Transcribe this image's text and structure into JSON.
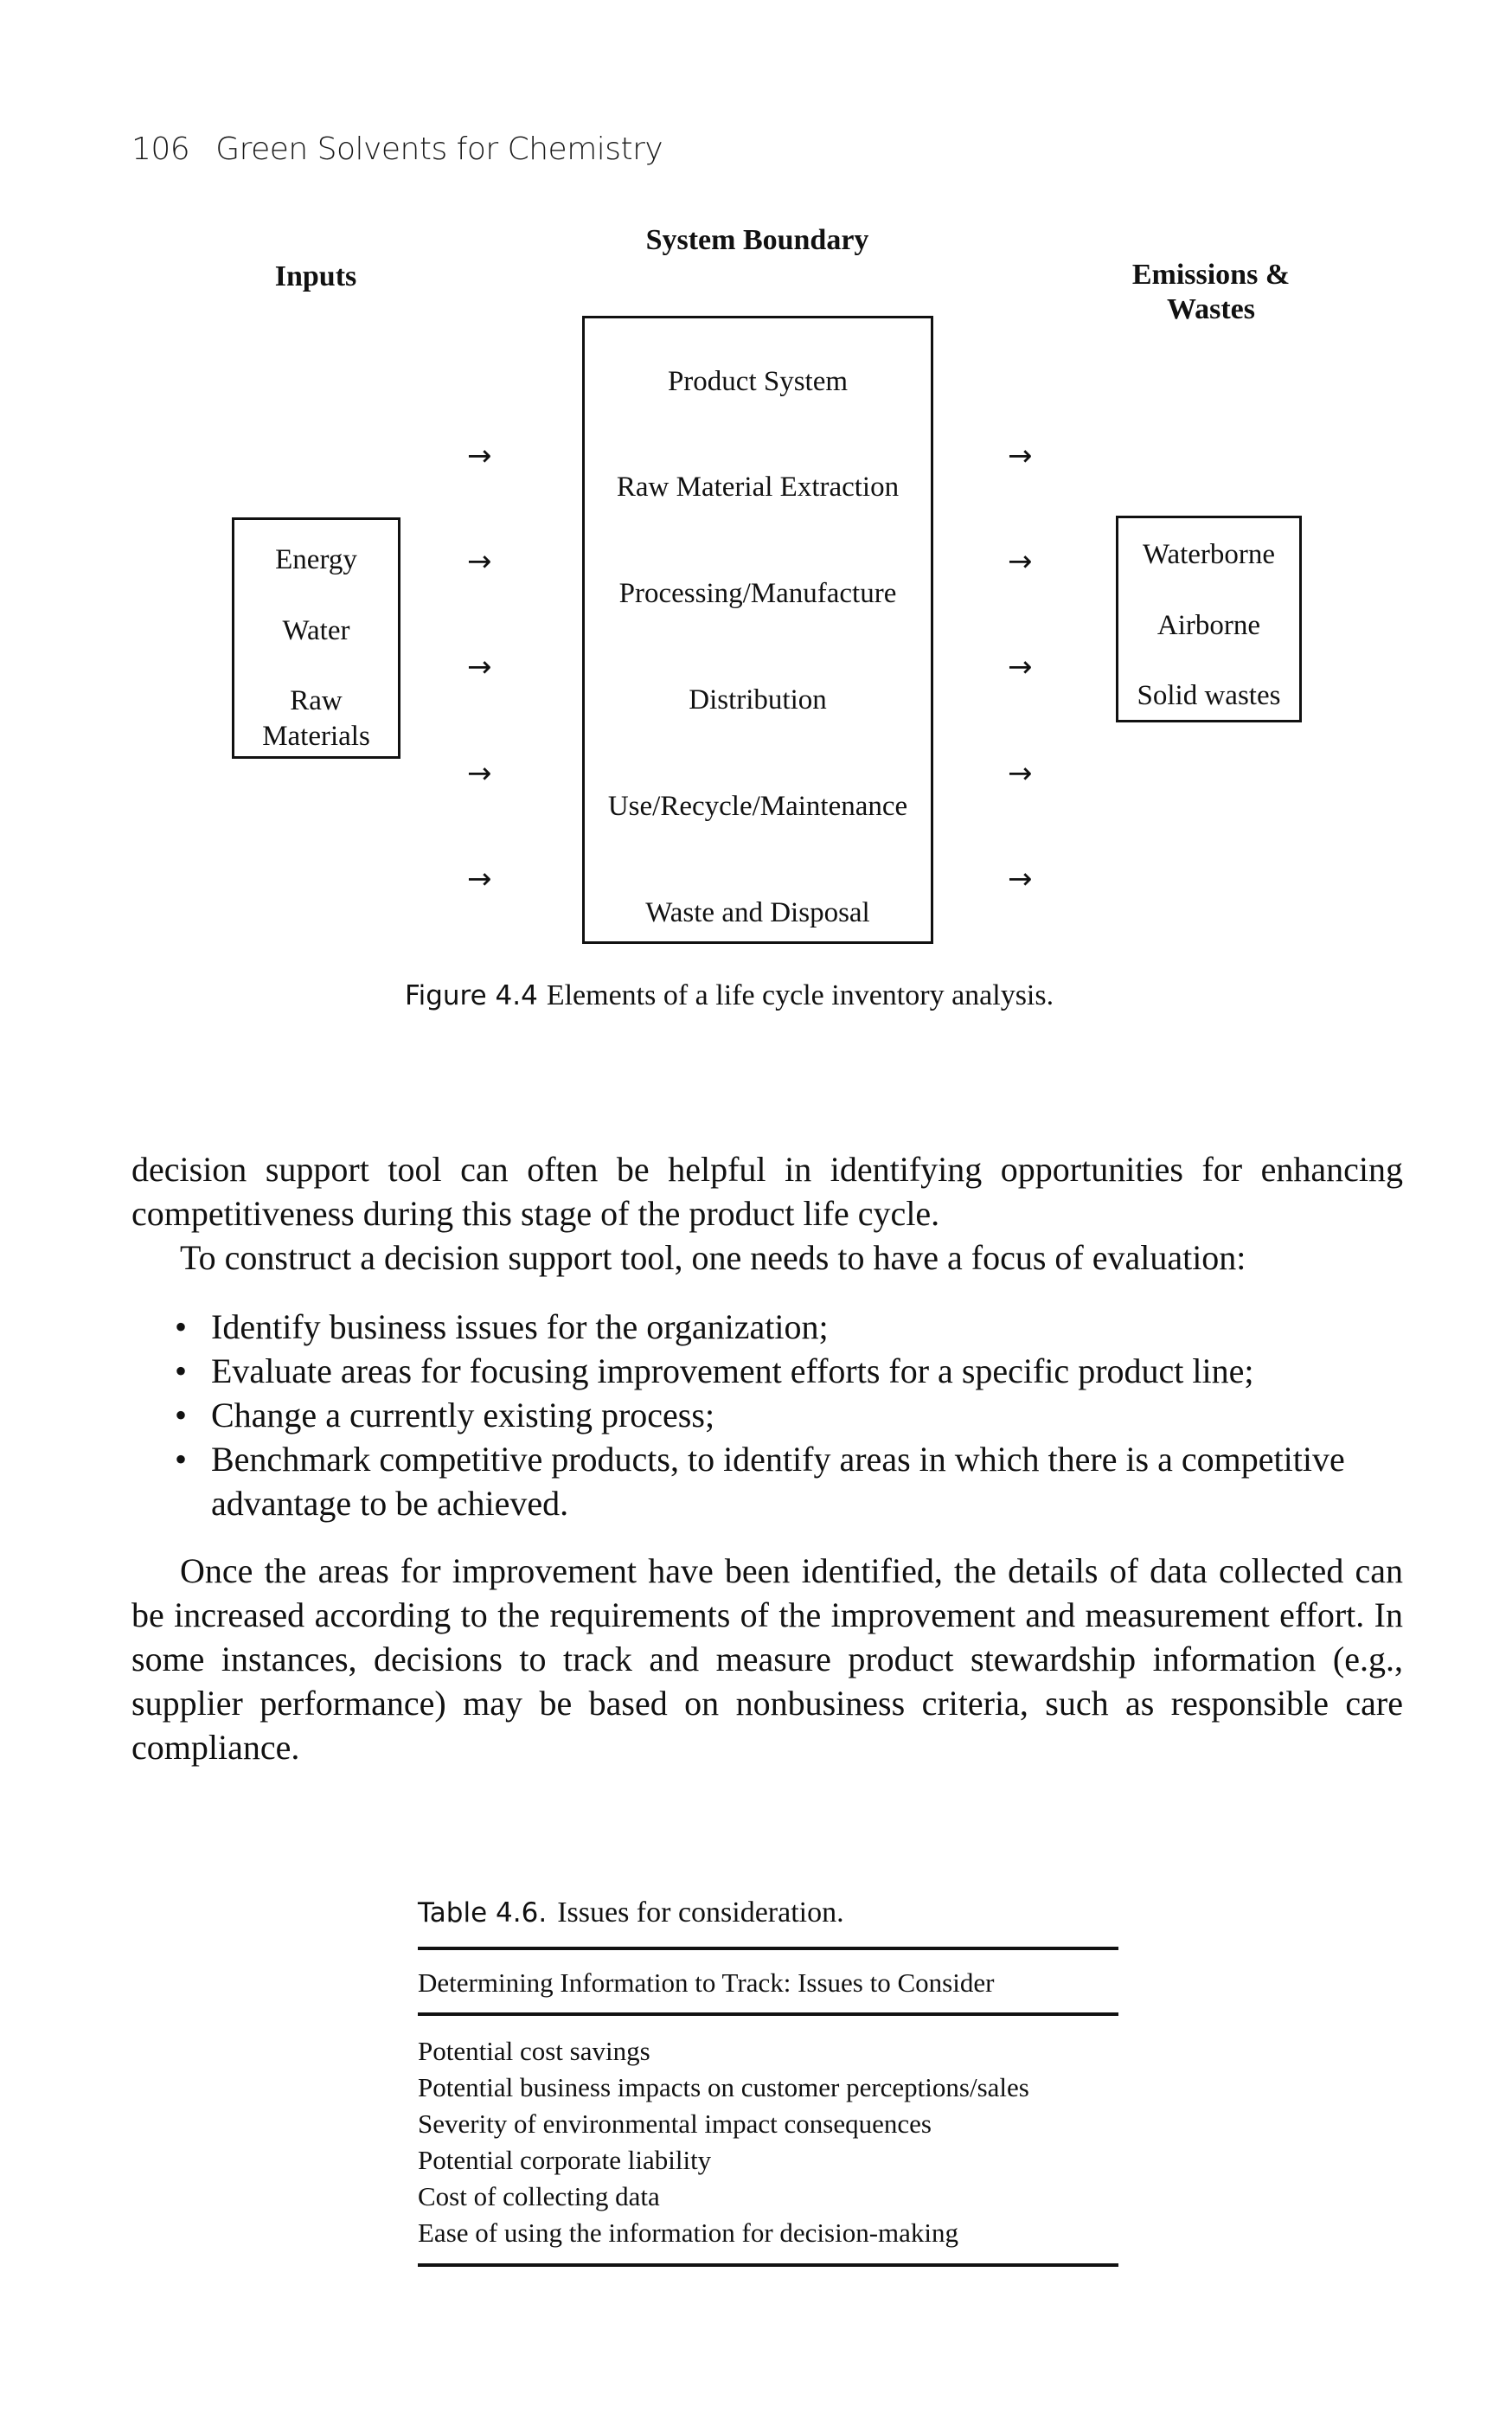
{
  "running_head": {
    "page_number": "106",
    "book_title": "Green Solvents for Chemistry"
  },
  "figure": {
    "system_boundary_label": "System Boundary",
    "inputs_label": "Inputs",
    "emissions_label_line1": "Emissions &",
    "emissions_label_line2": "Wastes",
    "product_system": {
      "title": "Product System",
      "stages": [
        "Raw Material Extraction",
        "Processing/Manufacture",
        "Distribution",
        "Use/Recycle/Maintenance",
        "Waste and Disposal"
      ]
    },
    "inputs": [
      "Energy",
      "Water",
      "Raw",
      "Materials"
    ],
    "emissions": [
      "Waterborne",
      "Airborne",
      "Solid wastes"
    ],
    "arrow_glyph": "→",
    "caption_label": "Figure 4.4",
    "caption_text": "Elements of a life cycle inventory analysis."
  },
  "body": {
    "para1": "decision support tool can often be helpful in identifying opportunities for enhancing competitiveness during this stage of the product life cycle.",
    "para2": "To construct a decision support tool, one needs to have a focus of evaluation:",
    "bullet_glyph": "•",
    "bullets": [
      "Identify business issues for the organization;",
      "Evaluate areas for focusing improvement efforts for a specific product line;",
      "Change a currently existing process;",
      "Benchmark competitive products, to identify areas in which there is a competitive advantage to be achieved."
    ],
    "para3": "Once the areas for improvement have been identified, the details of data collected can be increased according to the requirements of the improvement and measurement effort. In some instances, decisions to track and measure product stewardship information (e.g., supplier performance) may be based on nonbusiness criteria, such as responsible care compliance."
  },
  "table": {
    "label": "Table 4.6.",
    "title": "Issues for consideration.",
    "header": "Determining Information to Track: Issues to Consider",
    "rows": [
      "Potential cost savings",
      "Potential business impacts on customer perceptions/sales",
      "Severity of environmental impact consequences",
      "Potential corporate liability",
      "Cost of collecting data",
      "Ease of using the information for decision-making"
    ]
  }
}
